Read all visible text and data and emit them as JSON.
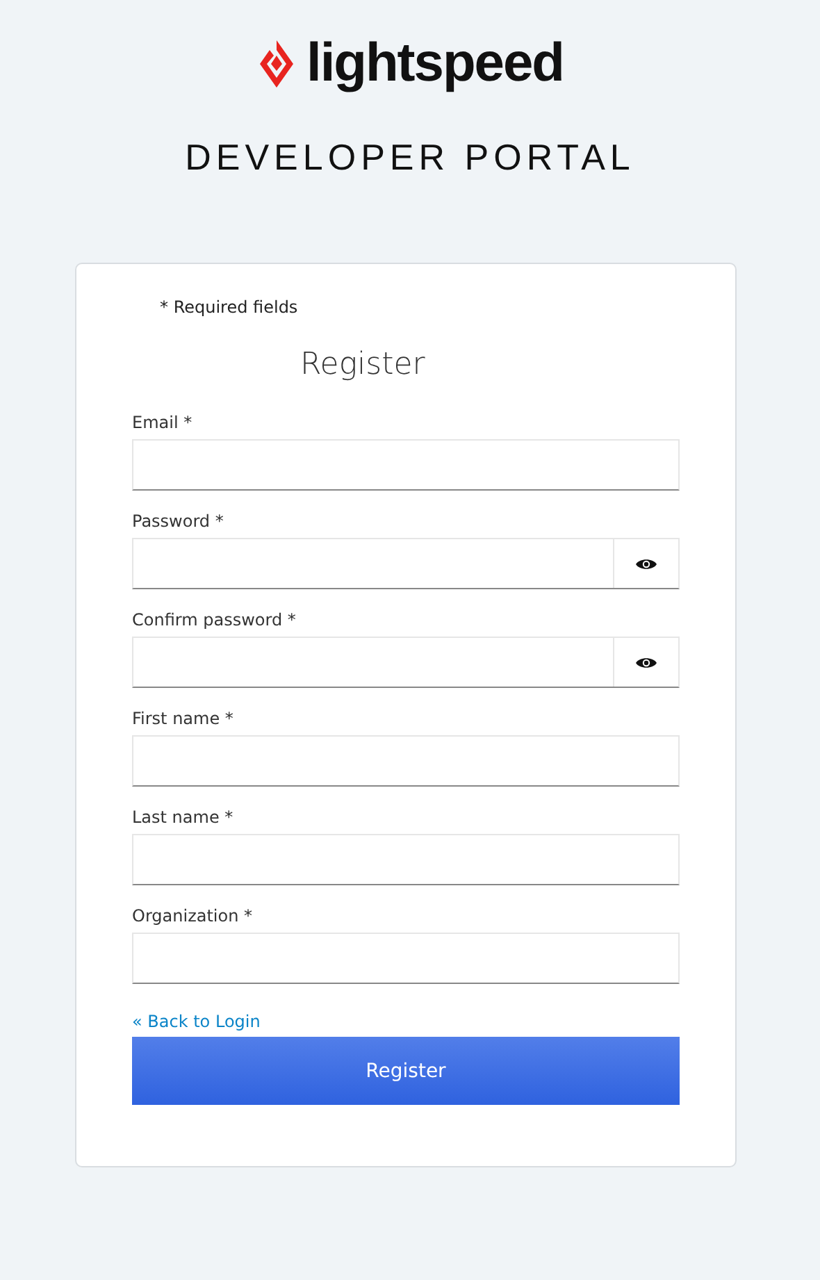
{
  "brand": {
    "name": "lightspeed",
    "subtitle": "DEVELOPER PORTAL"
  },
  "form": {
    "note": "* Required fields",
    "title": "Register",
    "fields": [
      {
        "label": "Email *",
        "kind": "text"
      },
      {
        "label": "Password *",
        "kind": "password"
      },
      {
        "label": "Confirm password *",
        "kind": "password"
      },
      {
        "label": "First name *",
        "kind": "text"
      },
      {
        "label": "Last name *",
        "kind": "text"
      },
      {
        "label": "Organization *",
        "kind": "text"
      }
    ],
    "back_link": "« Back to Login",
    "submit": "Register"
  }
}
